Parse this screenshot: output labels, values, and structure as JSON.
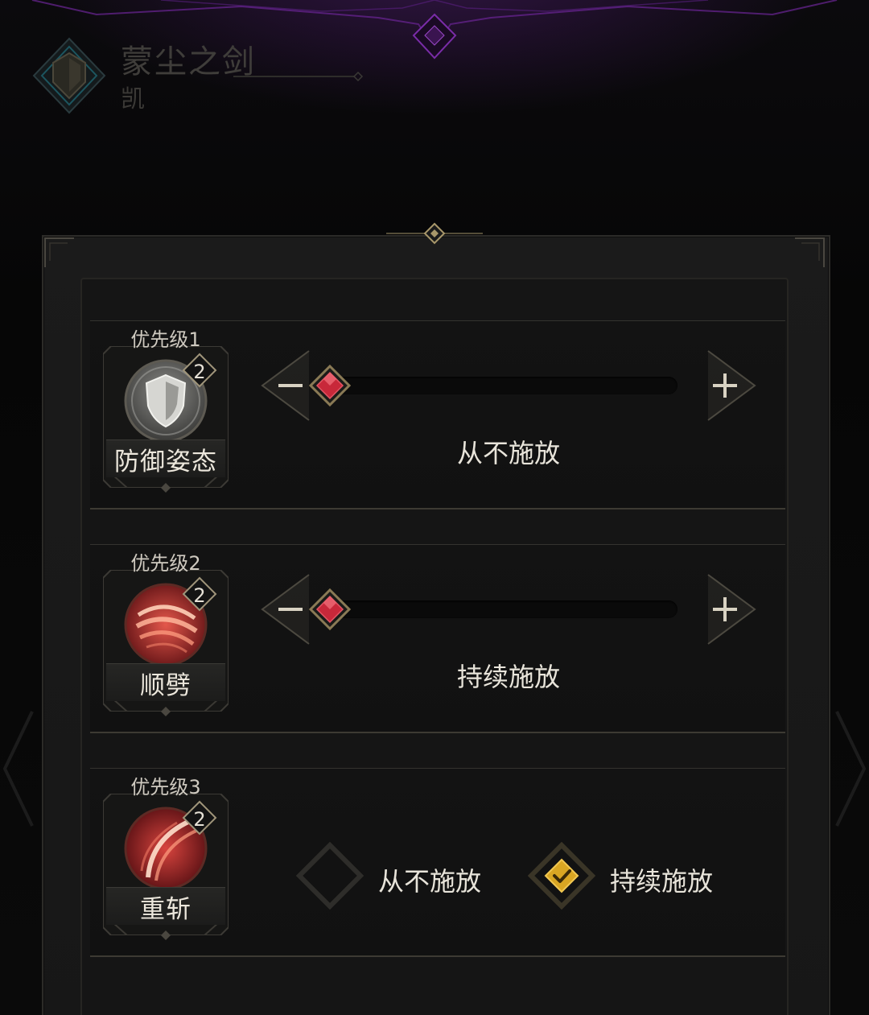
{
  "hero": {
    "name": "蒙尘之剑",
    "player": "凯"
  },
  "skills": [
    {
      "priority": "优先级1",
      "name": "防御姿态",
      "level": "2",
      "icon": "shield-icon",
      "control": "slider",
      "slider_fraction": 0.0,
      "value_label": "从不施放"
    },
    {
      "priority": "优先级2",
      "name": "顺劈",
      "level": "2",
      "icon": "cleave-icon",
      "control": "slider",
      "slider_fraction": 0.0,
      "value_label": "持续施放"
    },
    {
      "priority": "优先级3",
      "name": "重斩",
      "level": "2",
      "icon": "heavy-slash-icon",
      "control": "options",
      "options": [
        {
          "label": "从不施放",
          "checked": false
        },
        {
          "label": "持续施放",
          "checked": true
        }
      ]
    }
  ],
  "colors": {
    "accent_gold": "#d9a623",
    "gem_red": "#c8283a",
    "frame_gold": "#8a7a55",
    "top_purple": "#7a2ca8"
  }
}
